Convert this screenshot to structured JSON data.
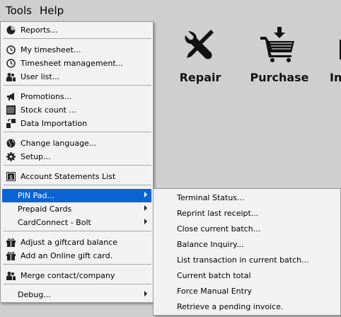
{
  "menubar": {
    "tools": "Tools",
    "help": "Help"
  },
  "tiles": [
    {
      "label": "Repair",
      "icon": "wrench-screwdriver-icon"
    },
    {
      "label": "Purchase",
      "icon": "shopping-cart-icon"
    },
    {
      "label": "In",
      "icon": "partial-icon"
    }
  ],
  "menu": {
    "reports": "Reports...",
    "my_timesheet": "My timesheet...",
    "timesheet_management": "Timesheet management...",
    "user_list": "User list...",
    "promotions": "Promotions...",
    "stock_count": "Stock count ...",
    "data_importation": "Data Importation",
    "change_language": "Change language...",
    "setup": "Setup...",
    "account_statements": "Account Statements List",
    "pin_pad": "PIN Pad...",
    "prepaid_cards": "Prepaid Cards",
    "cardconnect": "CardConnect - Bolt",
    "adjust_giftcard": "Adjust a giftcard balance",
    "add_online_gift": "Add an Online gift card.",
    "merge_contact": "Merge contact/company",
    "debug": "Debug..."
  },
  "submenu": {
    "items": [
      "Terminal Status...",
      "Reprint last receipt...",
      "Close current batch...",
      "Balance Inquiry...",
      "List transaction in current batch...",
      "Current batch total",
      "Force Manual Entry",
      "Retrieve a pending invoice."
    ]
  },
  "colors": {
    "highlight": "#0a64d6",
    "menu_bg": "#f2f2f2",
    "window_bg": "#cfcfcf"
  }
}
